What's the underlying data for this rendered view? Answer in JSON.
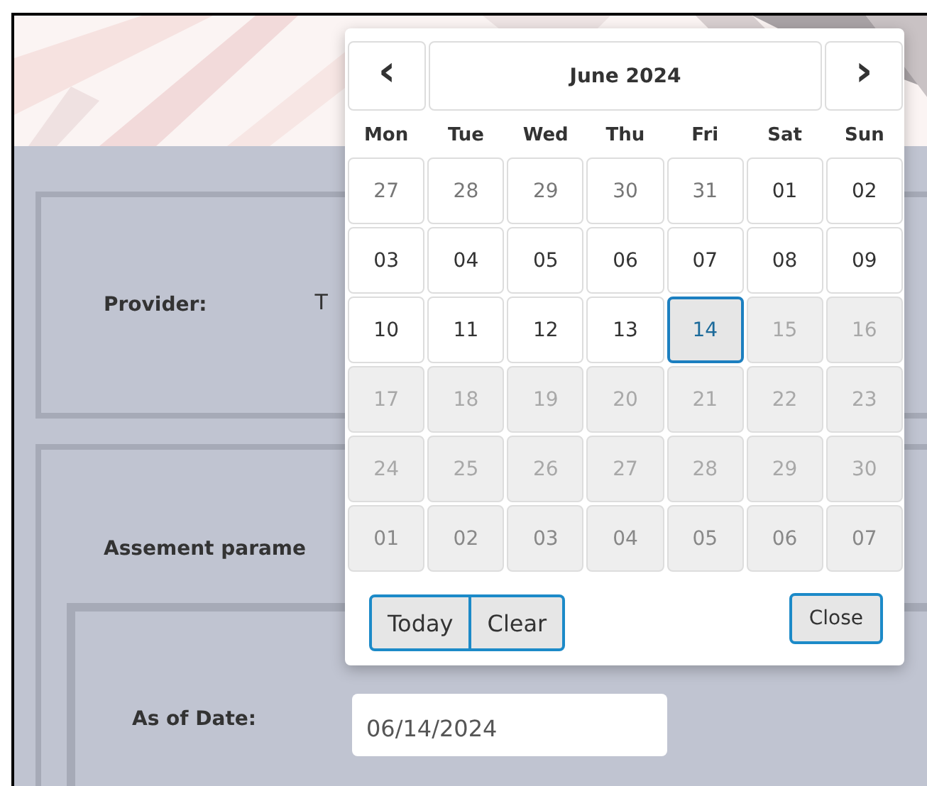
{
  "provider": {
    "label": "Provider:",
    "value": "T"
  },
  "assessment": {
    "label": "Assement parame"
  },
  "as_of_date": {
    "label": "As of Date:",
    "value": "06/14/2024"
  },
  "datepicker": {
    "prev": "‹",
    "title": "June 2024",
    "next": "›",
    "weekdays": [
      "Mon",
      "Tue",
      "Wed",
      "Thu",
      "Fri",
      "Sat",
      "Sun"
    ],
    "weeks": [
      [
        {
          "day": "27",
          "other_month": true,
          "disabled": false,
          "selected": false
        },
        {
          "day": "28",
          "other_month": true,
          "disabled": false,
          "selected": false
        },
        {
          "day": "29",
          "other_month": true,
          "disabled": false,
          "selected": false
        },
        {
          "day": "30",
          "other_month": true,
          "disabled": false,
          "selected": false
        },
        {
          "day": "31",
          "other_month": true,
          "disabled": false,
          "selected": false
        },
        {
          "day": "01",
          "other_month": false,
          "disabled": false,
          "selected": false
        },
        {
          "day": "02",
          "other_month": false,
          "disabled": false,
          "selected": false
        }
      ],
      [
        {
          "day": "03",
          "other_month": false,
          "disabled": false,
          "selected": false
        },
        {
          "day": "04",
          "other_month": false,
          "disabled": false,
          "selected": false
        },
        {
          "day": "05",
          "other_month": false,
          "disabled": false,
          "selected": false
        },
        {
          "day": "06",
          "other_month": false,
          "disabled": false,
          "selected": false
        },
        {
          "day": "07",
          "other_month": false,
          "disabled": false,
          "selected": false
        },
        {
          "day": "08",
          "other_month": false,
          "disabled": false,
          "selected": false
        },
        {
          "day": "09",
          "other_month": false,
          "disabled": false,
          "selected": false
        }
      ],
      [
        {
          "day": "10",
          "other_month": false,
          "disabled": false,
          "selected": false
        },
        {
          "day": "11",
          "other_month": false,
          "disabled": false,
          "selected": false
        },
        {
          "day": "12",
          "other_month": false,
          "disabled": false,
          "selected": false
        },
        {
          "day": "13",
          "other_month": false,
          "disabled": false,
          "selected": false
        },
        {
          "day": "14",
          "other_month": false,
          "disabled": false,
          "selected": true
        },
        {
          "day": "15",
          "other_month": false,
          "disabled": true,
          "selected": false
        },
        {
          "day": "16",
          "other_month": false,
          "disabled": true,
          "selected": false
        }
      ],
      [
        {
          "day": "17",
          "other_month": false,
          "disabled": true,
          "selected": false
        },
        {
          "day": "18",
          "other_month": false,
          "disabled": true,
          "selected": false
        },
        {
          "day": "19",
          "other_month": false,
          "disabled": true,
          "selected": false
        },
        {
          "day": "20",
          "other_month": false,
          "disabled": true,
          "selected": false
        },
        {
          "day": "21",
          "other_month": false,
          "disabled": true,
          "selected": false
        },
        {
          "day": "22",
          "other_month": false,
          "disabled": true,
          "selected": false
        },
        {
          "day": "23",
          "other_month": false,
          "disabled": true,
          "selected": false
        }
      ],
      [
        {
          "day": "24",
          "other_month": false,
          "disabled": true,
          "selected": false
        },
        {
          "day": "25",
          "other_month": false,
          "disabled": true,
          "selected": false
        },
        {
          "day": "26",
          "other_month": false,
          "disabled": true,
          "selected": false
        },
        {
          "day": "27",
          "other_month": false,
          "disabled": true,
          "selected": false
        },
        {
          "day": "28",
          "other_month": false,
          "disabled": true,
          "selected": false
        },
        {
          "day": "29",
          "other_month": false,
          "disabled": true,
          "selected": false
        },
        {
          "day": "30",
          "other_month": false,
          "disabled": true,
          "selected": false
        }
      ],
      [
        {
          "day": "01",
          "other_month": true,
          "disabled": true,
          "selected": false
        },
        {
          "day": "02",
          "other_month": true,
          "disabled": true,
          "selected": false
        },
        {
          "day": "03",
          "other_month": true,
          "disabled": true,
          "selected": false
        },
        {
          "day": "04",
          "other_month": true,
          "disabled": true,
          "selected": false
        },
        {
          "day": "05",
          "other_month": true,
          "disabled": true,
          "selected": false
        },
        {
          "day": "06",
          "other_month": true,
          "disabled": true,
          "selected": false
        },
        {
          "day": "07",
          "other_month": true,
          "disabled": true,
          "selected": false
        }
      ]
    ],
    "buttons": {
      "today": "Today",
      "clear": "Clear",
      "close": "Close"
    }
  }
}
